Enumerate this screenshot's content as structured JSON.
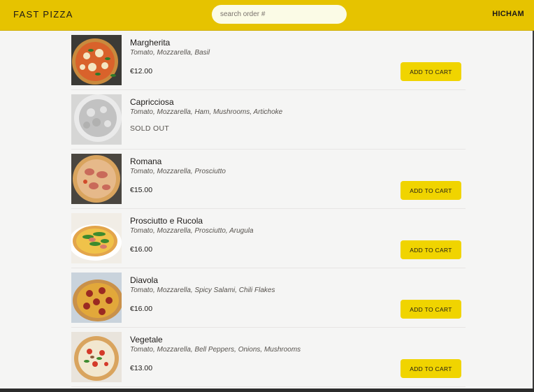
{
  "header": {
    "logo": "FAST PIZZA",
    "search_placeholder": "search order #",
    "username": "HICHAM"
  },
  "menu": {
    "add_to_cart_label": "ADD TO CART",
    "sold_out_label": "SOLD OUT",
    "items": [
      {
        "name": "Margherita",
        "ingredients": "Tomato, Mozzarella, Basil",
        "price": "€12.00",
        "sold_out": false,
        "image": "margherita-pizza-image"
      },
      {
        "name": "Capricciosa",
        "ingredients": "Tomato, Mozzarella, Ham, Mushrooms, Artichoke",
        "price": "",
        "sold_out": true,
        "image": "capricciosa-pizza-image"
      },
      {
        "name": "Romana",
        "ingredients": "Tomato, Mozzarella, Prosciutto",
        "price": "€15.00",
        "sold_out": false,
        "image": "romana-pizza-image"
      },
      {
        "name": "Prosciutto e Rucola",
        "ingredients": "Tomato, Mozzarella, Prosciutto, Arugula",
        "price": "€16.00",
        "sold_out": false,
        "image": "prosciutto-rucola-pizza-image"
      },
      {
        "name": "Diavola",
        "ingredients": "Tomato, Mozzarella, Spicy Salami, Chili Flakes",
        "price": "€16.00",
        "sold_out": false,
        "image": "diavola-pizza-image"
      },
      {
        "name": "Vegetale",
        "ingredients": "Tomato, Mozzarella, Bell Peppers, Onions, Mushrooms",
        "price": "€13.00",
        "sold_out": false,
        "image": "vegetale-pizza-image"
      }
    ]
  }
}
